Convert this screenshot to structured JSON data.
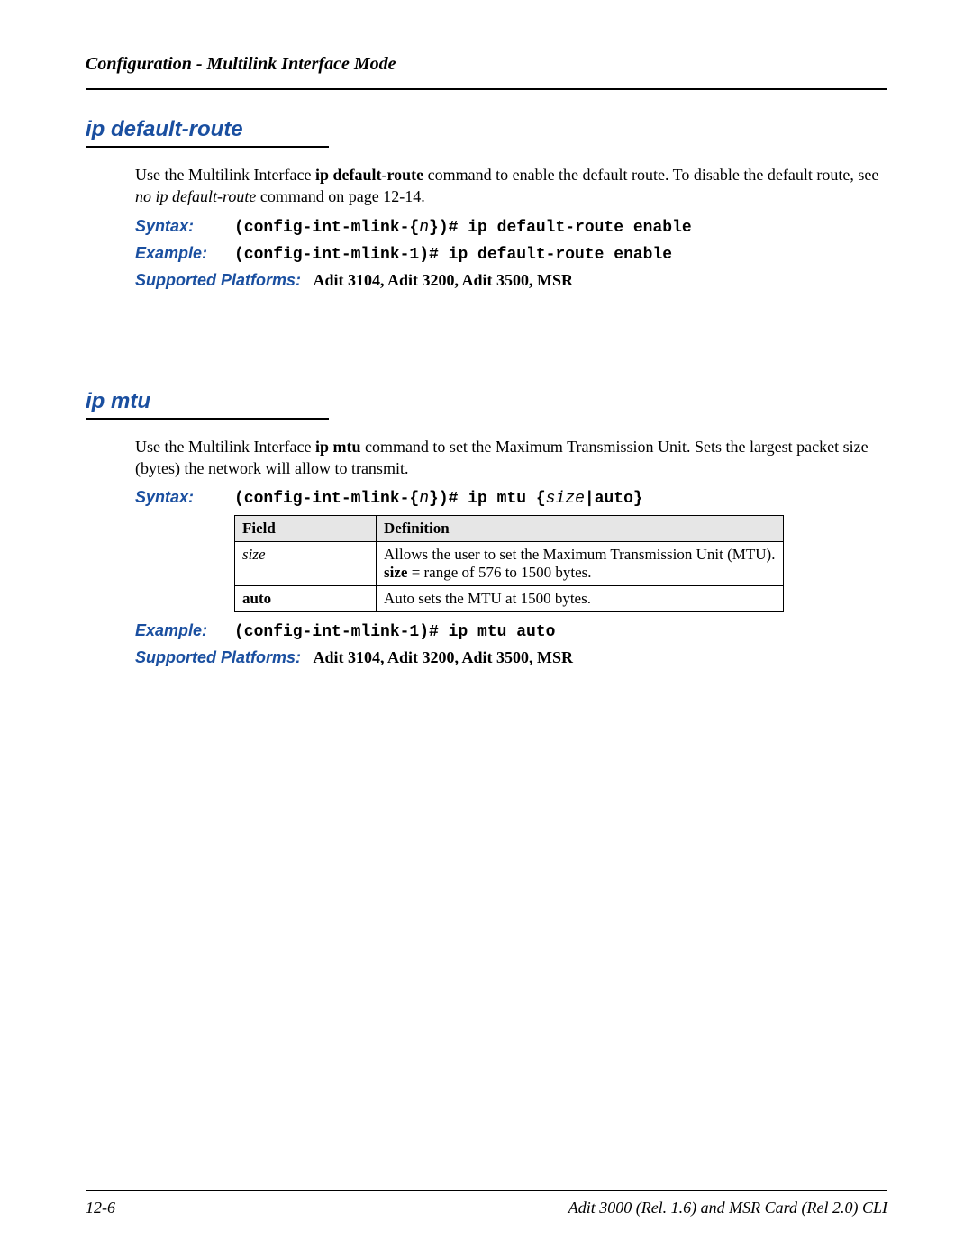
{
  "header": {
    "running_title": "Configuration - Multilink Interface Mode"
  },
  "section1": {
    "title": "ip default-route",
    "intro_pre": "Use the Multilink Interface ",
    "intro_cmd": "ip default-route",
    "intro_mid": " command to enable the default route. To disable the default route, see ",
    "intro_ref": "no ip default-route",
    "intro_post": " command on page 12-14.",
    "syntax_label": "Syntax:",
    "syntax_pre": "(config-int-mlink-{",
    "syntax_n": "n",
    "syntax_post": "})# ip default-route enable",
    "example_label": "Example:",
    "example_val": "(config-int-mlink-1)# ip default-route enable",
    "platforms_label": "Supported Platforms:",
    "platforms_val": "Adit 3104, Adit 3200, Adit 3500, MSR"
  },
  "section2": {
    "title": "ip mtu",
    "intro_pre": "Use the Multilink Interface ",
    "intro_cmd": "ip mtu",
    "intro_post": " command to set the Maximum Transmission Unit. Sets the largest packet size (bytes) the network will allow to transmit.",
    "syntax_label": "Syntax:",
    "syntax_pre": "(config-int-mlink-{",
    "syntax_n": "n",
    "syntax_mid": "})# ip mtu {",
    "syntax_size": "size",
    "syntax_pipe": "|",
    "syntax_auto": "auto",
    "syntax_close": "}",
    "table": {
      "h1": "Field",
      "h2": "Definition",
      "r1c1": "size",
      "r1c2a": "Allows the user to set the Maximum Transmission Unit (MTU).",
      "r1c2b": "size",
      "r1c2c": " = range of 576 to 1500 bytes.",
      "r2c1": "auto",
      "r2c2": "Auto sets the MTU at 1500 bytes."
    },
    "example_label": "Example:",
    "example_val": "(config-int-mlink-1)# ip mtu auto",
    "platforms_label": "Supported Platforms:",
    "platforms_val": "Adit 3104, Adit 3200, Adit 3500, MSR"
  },
  "footer": {
    "page_num": "12-6",
    "doc_title": "Adit 3000 (Rel. 1.6) and MSR Card (Rel 2.0) CLI"
  }
}
